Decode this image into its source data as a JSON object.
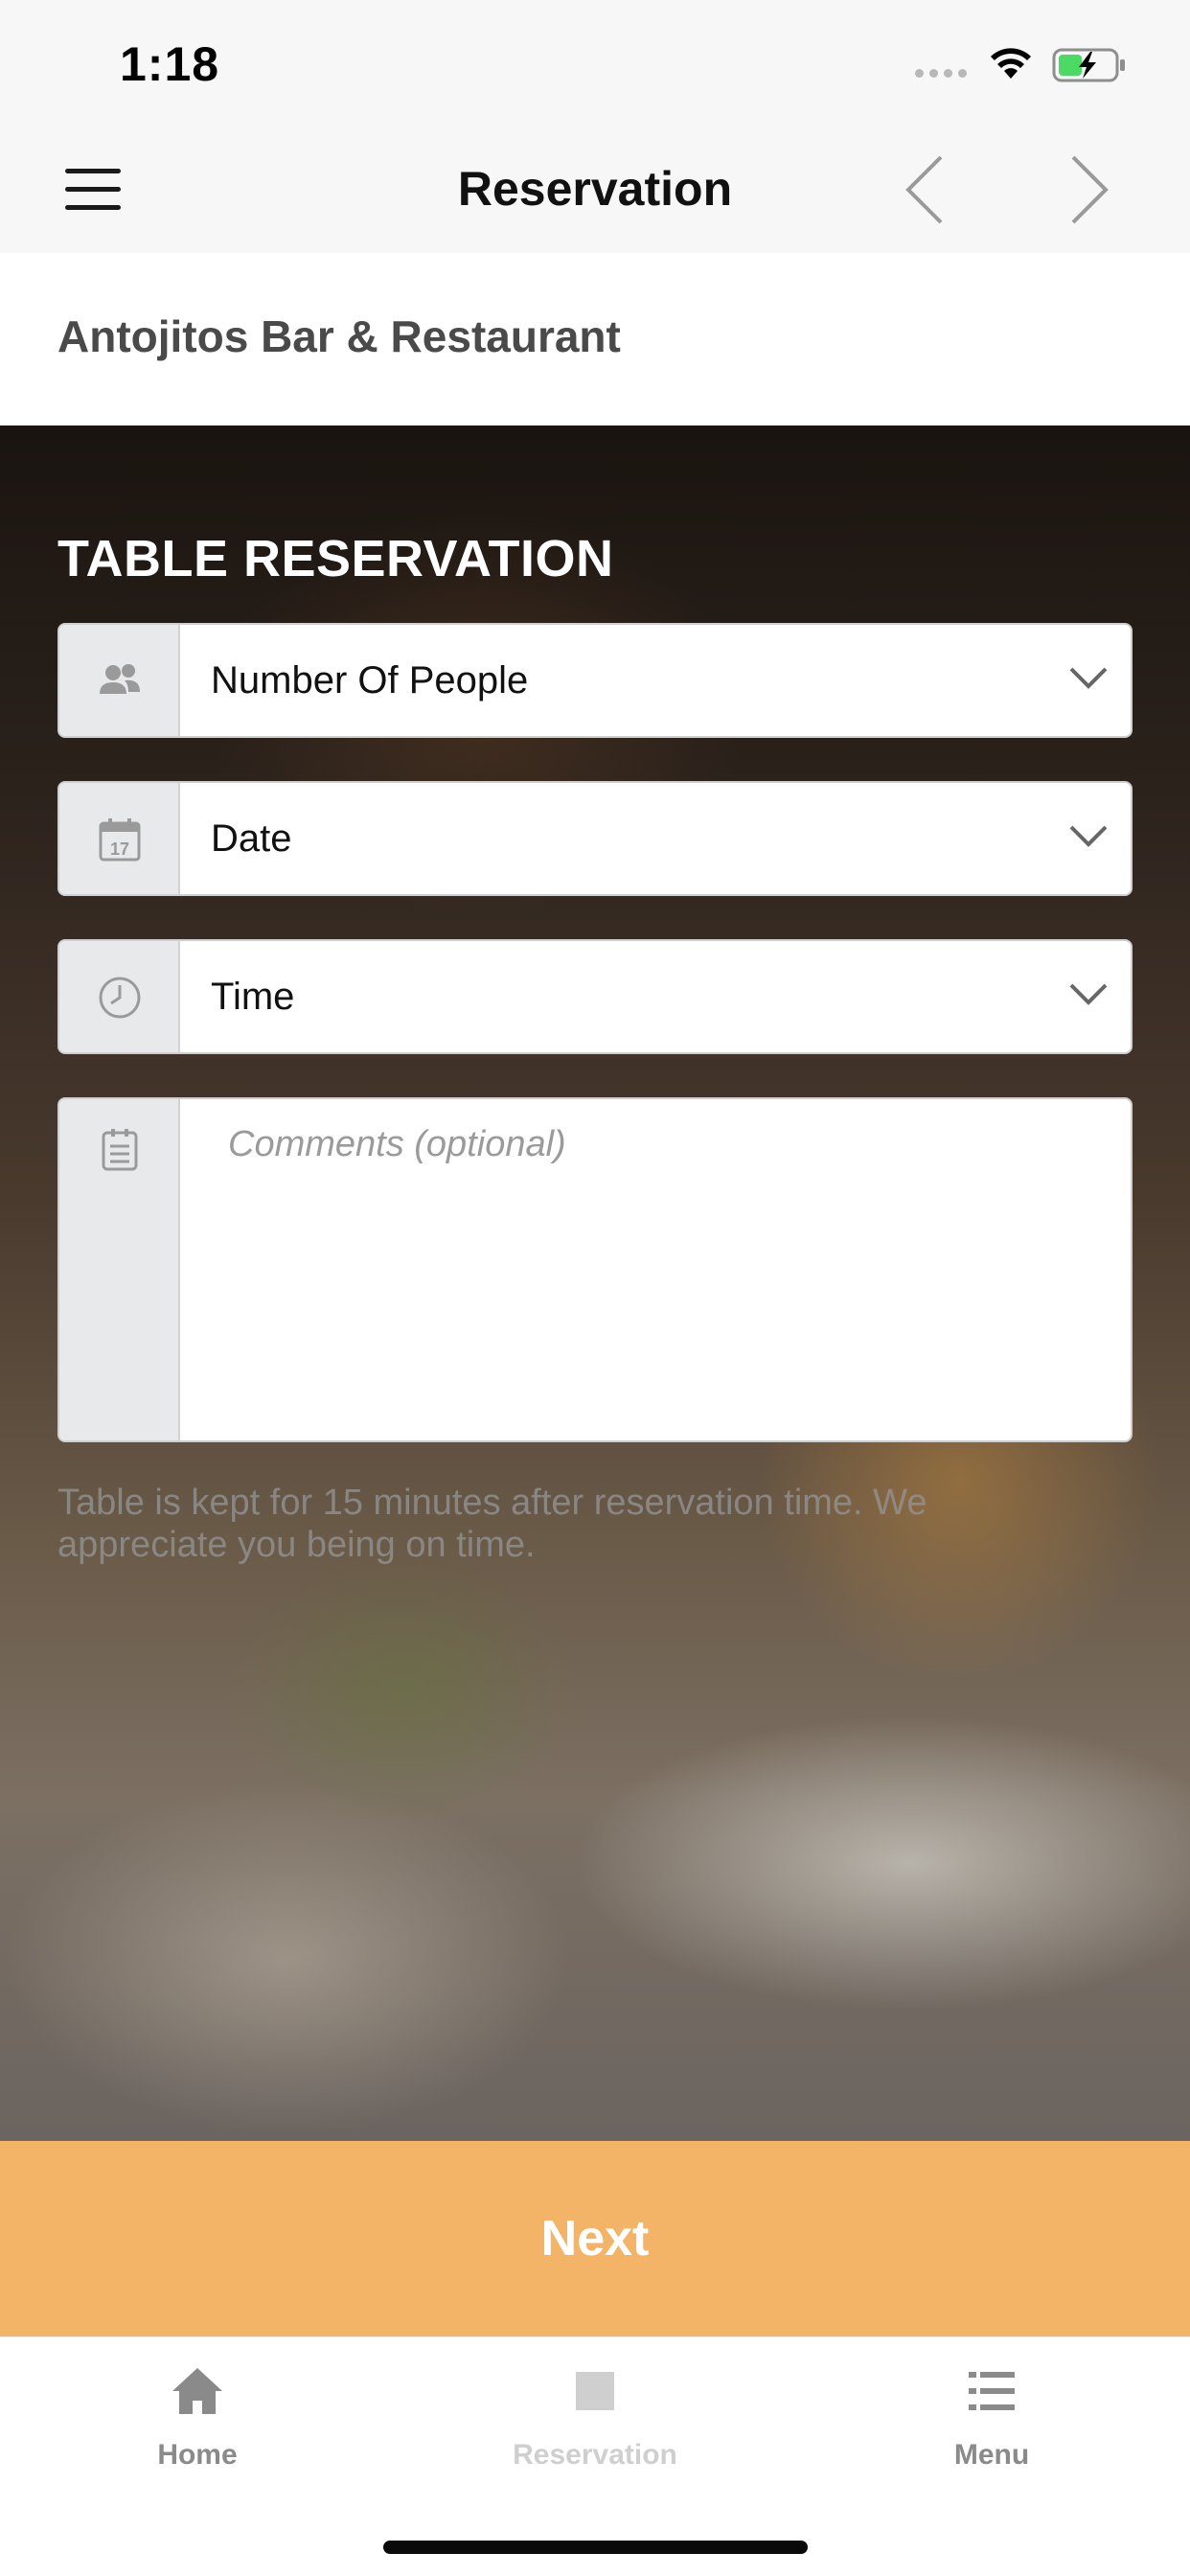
{
  "status_bar": {
    "time": "1:18"
  },
  "nav": {
    "title": "Reservation"
  },
  "restaurant": {
    "name": "Antojitos Bar & Restaurant"
  },
  "form": {
    "section_title": "TABLE RESERVATION",
    "people_label": "Number Of People",
    "date_label": "Date",
    "time_label": "Time",
    "comments_placeholder": "Comments (optional)",
    "note": "Table is kept for 15 minutes after reservation time. We appreciate you being on time."
  },
  "next_button": {
    "label": "Next"
  },
  "tabs": [
    {
      "label": "Home",
      "icon": "home-icon",
      "color": "#8a8a8a"
    },
    {
      "label": "Reservation",
      "icon": "square-icon",
      "color": "#cfcfcf"
    },
    {
      "label": "Menu",
      "icon": "list-icon",
      "color": "#8a8a8a"
    }
  ],
  "colors": {
    "accent": "#f4b468",
    "icon_box": "#e8e9eb",
    "tab_active": "#cfcfcf",
    "tab_inactive": "#8a8a8a"
  }
}
